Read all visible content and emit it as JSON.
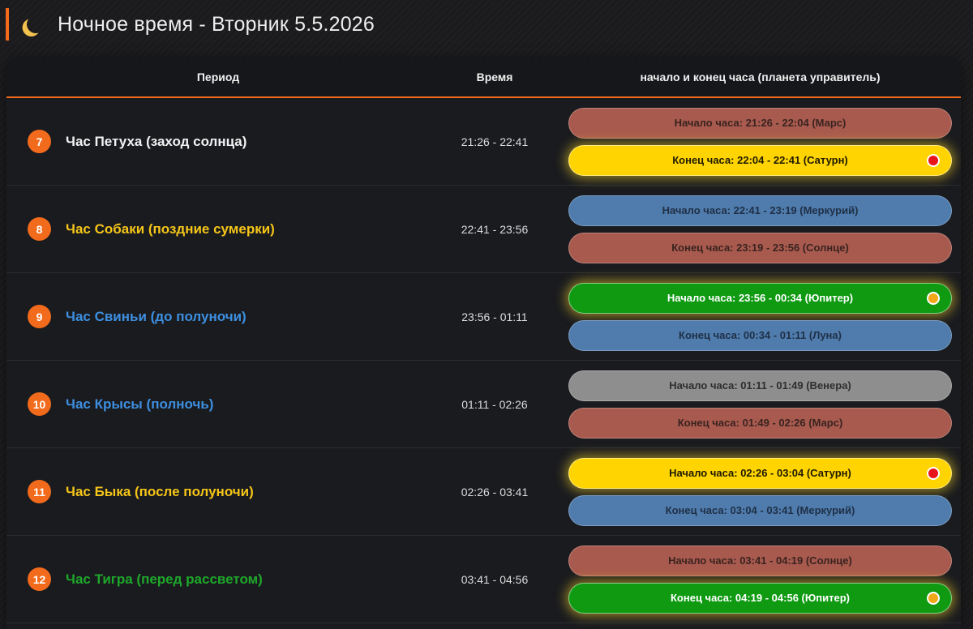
{
  "page": {
    "title": "Ночное время - Вторник 5.5.2026",
    "icon": "crescent-moon-icon"
  },
  "table": {
    "headers": {
      "period": "Период",
      "time": "Время",
      "hours": "начало и конец часа (планета управитель)"
    },
    "rows": [
      {
        "num": "7",
        "name": "Час Петуха (заход солнца)",
        "name_color": "#f2f2f2",
        "time": "21:26 - 22:41",
        "hours": [
          {
            "label": "Начало часа: 21:26 - 22:04 (Марс)",
            "bg": "#a85a4e",
            "fg": "#3a2320",
            "active": false
          },
          {
            "label": "Конец часа: 22:04 - 22:41 (Сатурн)",
            "bg": "#ffd400",
            "fg": "#1e1a00",
            "active": true,
            "dot": "#e8141c"
          }
        ]
      },
      {
        "num": "8",
        "name": "Час Собаки (поздние сумерки)",
        "name_color": "#f5c518",
        "time": "22:41 - 23:56",
        "hours": [
          {
            "label": "Начало часа: 22:41 - 23:19 (Меркурий)",
            "bg": "#4f7cad",
            "fg": "#1f2f45",
            "active": false
          },
          {
            "label": "Конец часа: 23:19 - 23:56 (Солнце)",
            "bg": "#a85a4e",
            "fg": "#3a2320",
            "active": false
          }
        ]
      },
      {
        "num": "9",
        "name": "Час Свиньи (до полуночи)",
        "name_color": "#3d8fe0",
        "time": "23:56 - 01:11",
        "hours": [
          {
            "label": "Начало часа: 23:56 - 00:34 (Юпитер)",
            "bg": "#0f9a12",
            "fg": "#ffffff",
            "active": true,
            "dot": "#f0a818"
          },
          {
            "label": "Конец часа: 00:34 - 01:11 (Луна)",
            "bg": "#4f7cad",
            "fg": "#1f2f45",
            "active": false
          }
        ]
      },
      {
        "num": "10",
        "name": "Час Крысы (полночь)",
        "name_color": "#3d8fe0",
        "time": "01:11 - 02:26",
        "hours": [
          {
            "label": "Начало часа: 01:11 - 01:49 (Венера)",
            "bg": "#8e8e8e",
            "fg": "#2e2e2e",
            "active": false
          },
          {
            "label": "Конец часа: 01:49 - 02:26 (Марс)",
            "bg": "#a85a4e",
            "fg": "#3a2320",
            "active": false
          }
        ]
      },
      {
        "num": "11",
        "name": "Час Быка (после полуночи)",
        "name_color": "#f5c518",
        "time": "02:26 - 03:41",
        "hours": [
          {
            "label": "Начало часа: 02:26 - 03:04 (Сатурн)",
            "bg": "#ffd400",
            "fg": "#1e1a00",
            "active": true,
            "dot": "#e8141c"
          },
          {
            "label": "Конец часа: 03:04 - 03:41 (Меркурий)",
            "bg": "#4f7cad",
            "fg": "#1f2f45",
            "active": false
          }
        ]
      },
      {
        "num": "12",
        "name": "Час Тигра (перед рассветом)",
        "name_color": "#1ea82a",
        "time": "03:41 - 04:56",
        "hours": [
          {
            "label": "Начало часа: 03:41 - 04:19 (Солнце)",
            "bg": "#a85a4e",
            "fg": "#3a2320",
            "active": false
          },
          {
            "label": "Конец часа: 04:19 - 04:56 (Юпитер)",
            "bg": "#0f9a12",
            "fg": "#ffffff",
            "active": true,
            "dot": "#f0a818"
          }
        ]
      }
    ]
  }
}
